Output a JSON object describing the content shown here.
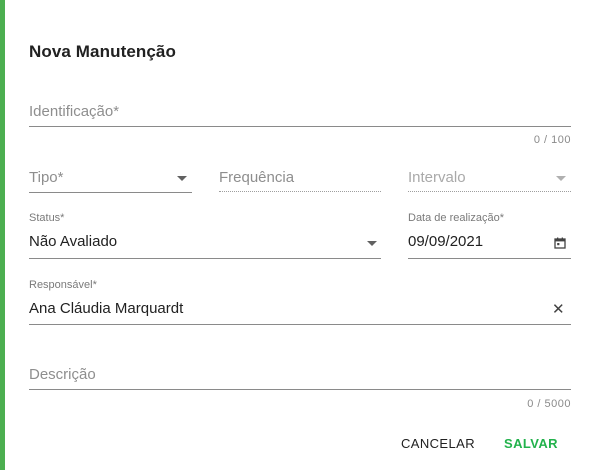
{
  "dialog": {
    "title": "Nova Manutenção",
    "accent_color": "#4caf50",
    "fields": {
      "identificacao": {
        "placeholder": "Identificação*",
        "counter": "0 / 100"
      },
      "tipo": {
        "placeholder": "Tipo*"
      },
      "frequencia": {
        "placeholder": "Frequência"
      },
      "intervalo": {
        "placeholder": "Intervalo"
      },
      "status": {
        "label": "Status*",
        "value": "Não Avaliado"
      },
      "data_realizacao": {
        "label": "Data de realização*",
        "value": "09/09/2021"
      },
      "responsavel": {
        "label": "Responsável*",
        "value": "Ana Cláudia Marquardt"
      },
      "descricao": {
        "placeholder": "Descrição",
        "counter": "0 / 5000"
      }
    },
    "actions": {
      "cancel_label": "CANCELAR",
      "save_label": "SALVAR",
      "save_color": "#22b24c"
    }
  }
}
